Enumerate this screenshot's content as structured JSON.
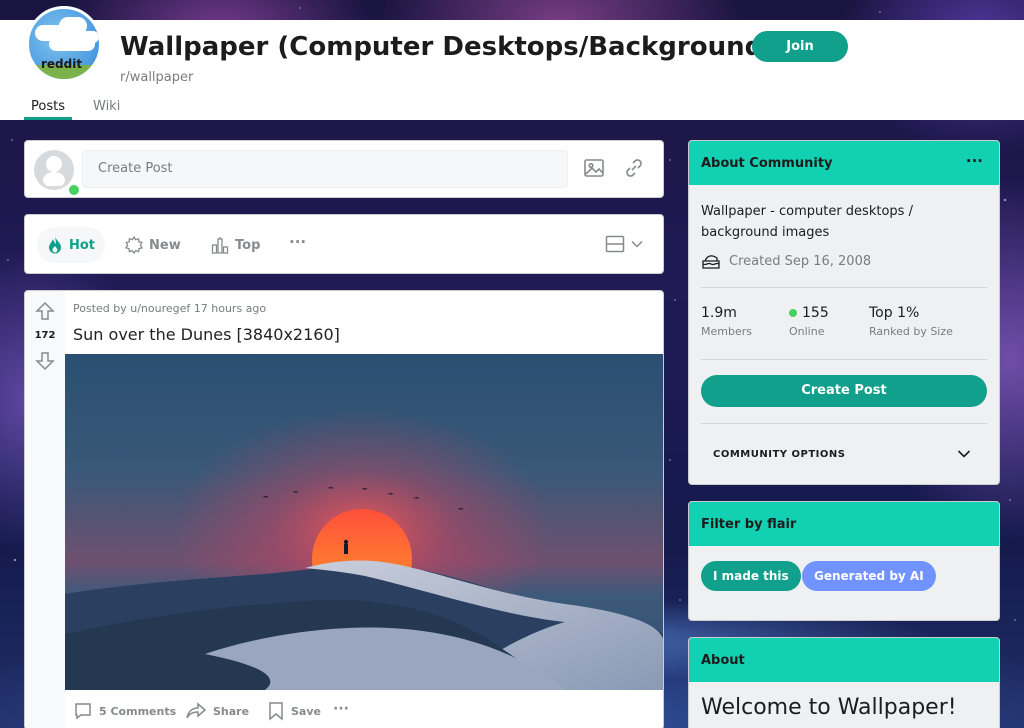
{
  "header": {
    "avatar_text": "reddit",
    "title": "Wallpaper (Computer Desktops/Backgrounds)",
    "handle": "r/wallpaper",
    "join_label": "Join",
    "tabs": [
      {
        "label": "Posts",
        "active": true
      },
      {
        "label": "Wiki",
        "active": false
      }
    ]
  },
  "create_post": {
    "placeholder": "Create Post"
  },
  "sort": {
    "items": [
      {
        "label": "Hot",
        "active": true
      },
      {
        "label": "New",
        "active": false
      },
      {
        "label": "Top",
        "active": false
      }
    ],
    "more": "···"
  },
  "post": {
    "votes": "172",
    "meta": "Posted by u/nouregef 17 hours ago",
    "title": "Sun over the Dunes [3840x2160]",
    "actions": {
      "comments": "5 Comments",
      "share": "Share",
      "save": "Save",
      "more": "···"
    }
  },
  "sidebar": {
    "about": {
      "heading": "About Community",
      "more": "···",
      "description": "Wallpaper - computer desktops / background images",
      "created": "Created Sep 16, 2008",
      "stats": [
        {
          "value": "1.9m",
          "label": "Members"
        },
        {
          "value": "155",
          "label": "Online"
        },
        {
          "value": "Top 1%",
          "label": "Ranked by Size"
        }
      ],
      "create_post_label": "Create Post",
      "community_options": "COMMUNITY OPTIONS"
    },
    "flair": {
      "heading": "Filter by flair",
      "chips": [
        {
          "label": "I made this",
          "color": "#11a08b"
        },
        {
          "label": "Generated by AI",
          "color": "#7193ff"
        }
      ]
    },
    "about2": {
      "heading": "About",
      "welcome": "Welcome to Wallpaper!"
    }
  },
  "colors": {
    "accent": "#11a08b",
    "header_band": "#11d1b2",
    "online": "#46d160"
  }
}
